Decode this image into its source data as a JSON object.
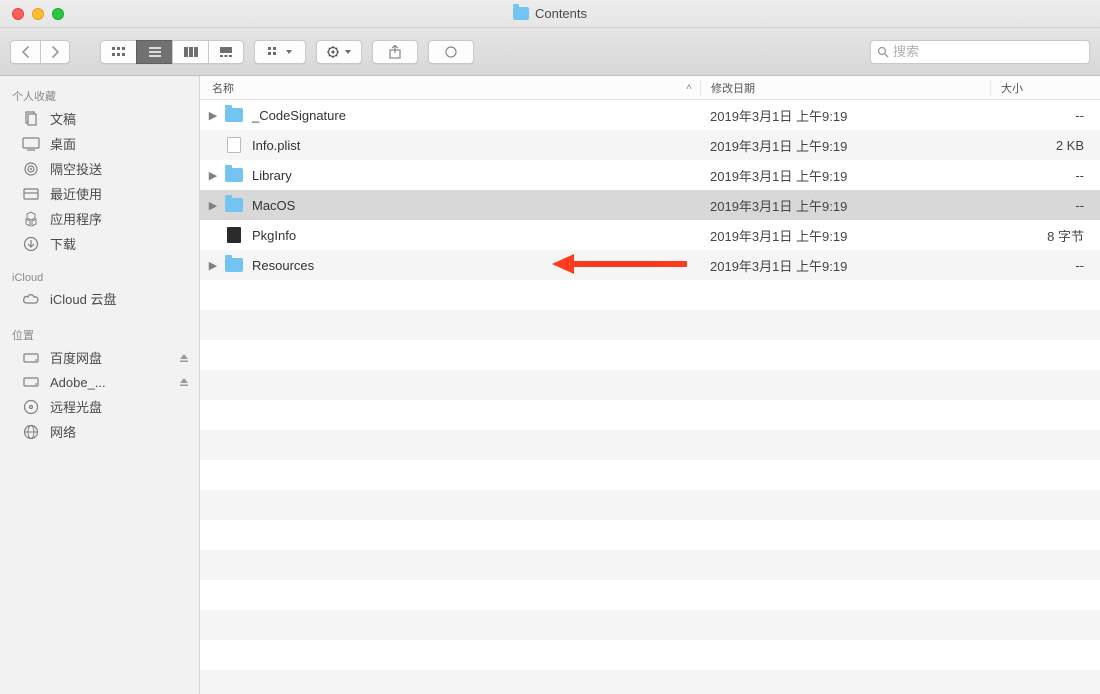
{
  "window": {
    "title": "Contents"
  },
  "search": {
    "placeholder": "搜索"
  },
  "sidebar": {
    "favorites": {
      "header": "个人收藏",
      "items": [
        {
          "label": "文稿",
          "icon": "documents"
        },
        {
          "label": "桌面",
          "icon": "desktop"
        },
        {
          "label": "隔空投送",
          "icon": "airdrop"
        },
        {
          "label": "最近使用",
          "icon": "recents"
        },
        {
          "label": "应用程序",
          "icon": "apps"
        },
        {
          "label": "下载",
          "icon": "downloads"
        }
      ]
    },
    "icloud": {
      "header": "iCloud",
      "items": [
        {
          "label": "iCloud 云盘",
          "icon": "cloud"
        }
      ]
    },
    "locations": {
      "header": "位置",
      "items": [
        {
          "label": "百度网盘",
          "icon": "disk",
          "eject": true
        },
        {
          "label": "Adobe_...",
          "icon": "disk",
          "eject": true
        },
        {
          "label": "远程光盘",
          "icon": "optical"
        },
        {
          "label": "网络",
          "icon": "network"
        }
      ]
    }
  },
  "columns": {
    "name": "名称",
    "date": "修改日期",
    "size": "大小"
  },
  "files": [
    {
      "name": "_CodeSignature",
      "type": "folder",
      "expandable": true,
      "date": "2019年3月1日 上午9:19",
      "size": "--"
    },
    {
      "name": "Info.plist",
      "type": "file",
      "expandable": false,
      "date": "2019年3月1日 上午9:19",
      "size": "2 KB"
    },
    {
      "name": "Library",
      "type": "folder",
      "expandable": true,
      "date": "2019年3月1日 上午9:19",
      "size": "--"
    },
    {
      "name": "MacOS",
      "type": "folder",
      "expandable": true,
      "selected": true,
      "date": "2019年3月1日 上午9:19",
      "size": "--"
    },
    {
      "name": "PkgInfo",
      "type": "exec",
      "expandable": false,
      "date": "2019年3月1日 上午9:19",
      "size": "8 字节"
    },
    {
      "name": "Resources",
      "type": "folder",
      "expandable": true,
      "date": "2019年3月1日 上午9:19",
      "size": "--"
    }
  ]
}
